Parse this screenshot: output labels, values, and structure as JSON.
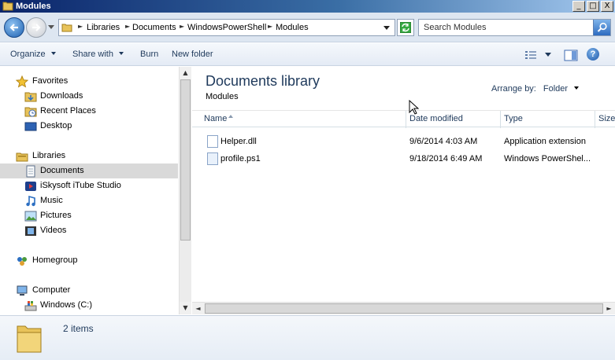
{
  "window": {
    "title": "Modules",
    "controls": {
      "minimize": "_",
      "maximize": "□",
      "close": "X"
    }
  },
  "address": {
    "crumbs": [
      "Libraries",
      "Documents",
      "WindowsPowerShell",
      "Modules"
    ],
    "search_placeholder": "Search Modules"
  },
  "toolbar": {
    "organize": "Organize",
    "share_with": "Share with",
    "burn": "Burn",
    "new_folder": "New folder",
    "help": "?"
  },
  "nav": {
    "favorites": "Favorites",
    "downloads": "Downloads",
    "recent_places": "Recent Places",
    "desktop": "Desktop",
    "libraries": "Libraries",
    "documents": "Documents",
    "itube": "iSkysoft iTube Studio",
    "music": "Music",
    "pictures": "Pictures",
    "videos": "Videos",
    "homegroup": "Homegroup",
    "computer": "Computer",
    "windows_c": "Windows (C:)"
  },
  "content": {
    "title": "Documents library",
    "subtitle": "Modules",
    "arrange_label": "Arrange by:",
    "arrange_value": "Folder",
    "columns": {
      "name": "Name",
      "date": "Date modified",
      "type": "Type",
      "size": "Size"
    },
    "files": [
      {
        "name": "Helper.dll",
        "date": "9/6/2014 4:03 AM",
        "type": "Application extension"
      },
      {
        "name": "profile.ps1",
        "date": "9/18/2014 6:49 AM",
        "type": "Windows PowerShel..."
      }
    ]
  },
  "status": {
    "count": "2 items"
  },
  "colors": {
    "title_gradient_start": "#0a246a",
    "title_gradient_end": "#a6caf0",
    "heading": "#1e395b",
    "selection": "#d9d9d9"
  }
}
